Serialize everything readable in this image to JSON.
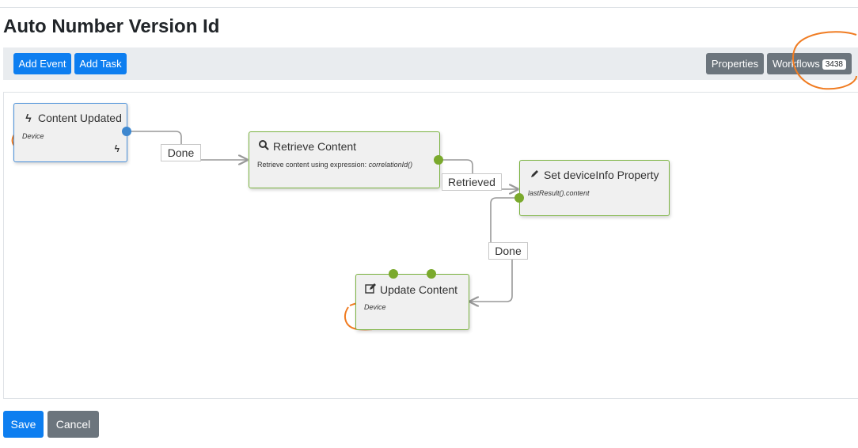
{
  "page": {
    "title": "Auto Number Version Id"
  },
  "toolbar": {
    "add_event": "Add Event",
    "add_task": "Add Task",
    "properties": "Properties",
    "workflows": "Workflows",
    "workflows_count": "3438"
  },
  "nodes": {
    "content_updated": {
      "title": "Content Updated",
      "subtitle": "Device",
      "icon": "bolt-icon"
    },
    "retrieve_content": {
      "title": "Retrieve Content",
      "subtitle_prefix": "Retrieve content using expression: ",
      "subtitle_expr": "correlationId()",
      "icon": "search-icon"
    },
    "set_deviceinfo": {
      "title": "Set deviceInfo Property",
      "subtitle": "lastResult().content",
      "icon": "pencil-icon"
    },
    "update_content": {
      "title": "Update Content",
      "subtitle": "Device",
      "icon": "edit-icon"
    }
  },
  "edges": {
    "done_1": "Done",
    "retrieved": "Retrieved",
    "done_2": "Done"
  },
  "footer": {
    "save": "Save",
    "cancel": "Cancel"
  },
  "colors": {
    "primary": "#0d7ef0",
    "secondary": "#6c757d",
    "event_border": "#4a90d9",
    "task_border": "#7cb342",
    "annotation": "#f07c22"
  }
}
